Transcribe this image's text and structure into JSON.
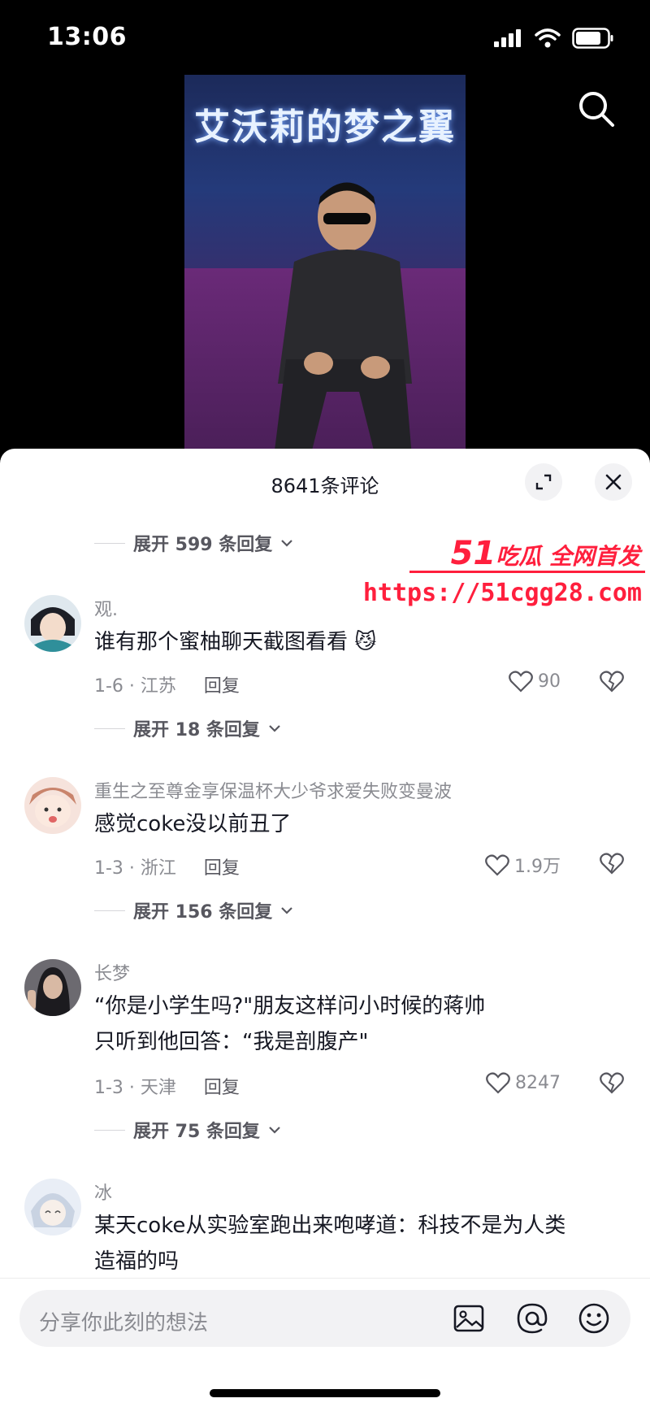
{
  "status_bar": {
    "time": "13:06"
  },
  "video": {
    "banner_text": "艾沃莉的梦之翼"
  },
  "sheet": {
    "title": "8641条评论"
  },
  "top_expand": {
    "label": "展开 599 条回复"
  },
  "watermark": {
    "brand_num": "51",
    "brand_text": "吃瓜 全网首发",
    "url": "https://51cgg28.com"
  },
  "comments": [
    {
      "user": "观.",
      "text": "谁有那个蜜柚聊天截图看看",
      "emoji": "😼",
      "meta": "1-6 · 江苏",
      "reply": "回复",
      "likes": "90",
      "expand": "展开 18 条回复"
    },
    {
      "user": "重生之至尊金享保温杯大少爷求爱失败变曼波",
      "text": "感觉coke没以前丑了",
      "meta": "1-3 · 浙江",
      "reply": "回复",
      "likes": "1.9万",
      "expand": "展开 156 条回复"
    },
    {
      "user": "长梦",
      "text_line1": "“你是小学生吗?\"朋友这样问小时候的蒋帅",
      "text_line2": "只听到他回答：“我是剖腹产\"",
      "meta": "1-3 · 天津",
      "reply": "回复",
      "likes": "8247",
      "expand": "展开 75 条回复"
    },
    {
      "user": "冰",
      "text_line1": "某天coke从实验室跑出来咆哮道：科技不是为人类",
      "text_line2": "造福的吗"
    }
  ],
  "input": {
    "placeholder": "分享你此刻的想法"
  },
  "icons": {
    "search": "search-icon",
    "expand": "expand-icon",
    "close": "close-icon",
    "heart": "heart-icon",
    "broken_heart": "broken-heart-icon",
    "image": "image-icon",
    "at": "at-icon",
    "emoji": "emoji-icon"
  },
  "colors": {
    "accent_watermark": "#ff1f3d",
    "text_primary": "#161823",
    "text_secondary": "#8a8b91"
  }
}
